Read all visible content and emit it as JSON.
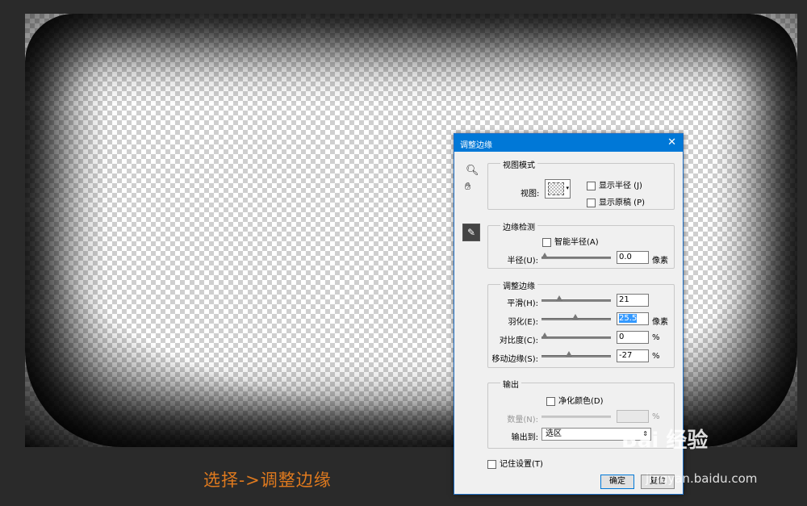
{
  "caption": "选择->调整边缘",
  "dialog": {
    "title": "调整边缘",
    "close_icon": "close-icon",
    "tools": [
      "zoom-icon",
      "hand-icon",
      "refine-radius-icon"
    ],
    "view_mode": {
      "group_title": "视图模式",
      "view_label": "视图:",
      "show_radius": "显示半径 (J)",
      "show_original": "显示原稿 (P)"
    },
    "edge_detection": {
      "group_title": "边缘检测",
      "smart_radius": "智能半径(A)",
      "radius_label": "半径(U):",
      "radius_value": "0.0",
      "radius_unit": "像素",
      "radius_slider": 0.0
    },
    "adjust_edge": {
      "group_title": "调整边缘",
      "smooth_label": "平滑(H):",
      "smooth_value": "21",
      "smooth_slider": 0.21,
      "feather_label": "羽化(E):",
      "feather_value": "25.5",
      "feather_unit": "像素",
      "feather_slider": 0.51,
      "contrast_label": "对比度(C):",
      "contrast_value": "0",
      "contrast_unit": "%",
      "contrast_slider": 0.0,
      "shift_label": "移动边缘(S):",
      "shift_value": "-27",
      "shift_unit": "%",
      "shift_slider": 0.37
    },
    "output": {
      "group_title": "输出",
      "decontaminate": "净化颜色(D)",
      "amount_label": "数量(N):",
      "amount_unit": "%",
      "output_to_label": "输出到:",
      "output_to_value": "选区"
    },
    "remember": "记住设置(T)",
    "ok_label": "确定",
    "reset_label": "复位"
  },
  "watermark": {
    "brand": "Bai 经验",
    "url": "jingyan.baidu.com"
  }
}
